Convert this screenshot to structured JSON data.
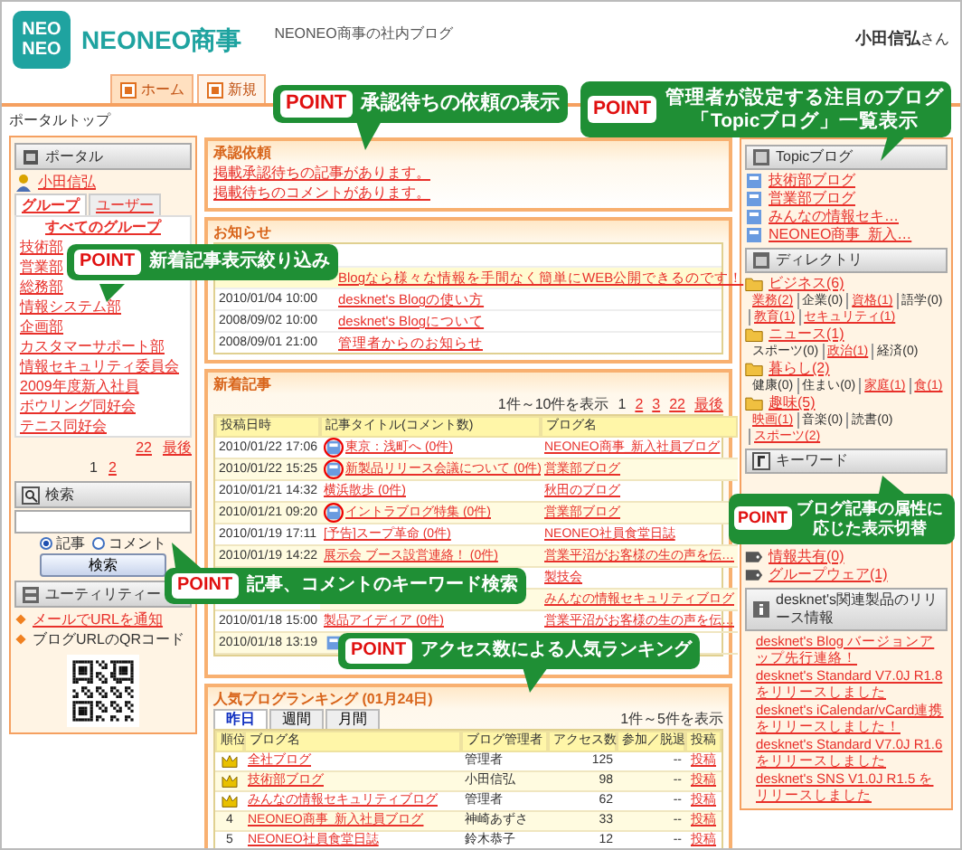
{
  "header": {
    "logo_lines": [
      "NEO",
      "NEO"
    ],
    "site_name": "NEONEO商事",
    "tagline": "NEONEO商事の社内ブログ",
    "user_name": "小田信弘",
    "user_suffix": "さん"
  },
  "nav_tabs": [
    {
      "label": "ホーム",
      "selected": true
    },
    {
      "label": "新規",
      "selected": false
    }
  ],
  "breadcrumb": "ポータルトップ",
  "portal": {
    "title": "ポータル",
    "user": "小田信弘",
    "tabs": [
      {
        "label": "グループ",
        "selected": true
      },
      {
        "label": "ユーザー",
        "selected": false
      }
    ],
    "all_groups": "すべてのグループ",
    "groups": [
      "技術部",
      "営業部",
      "総務部",
      "情報システム部",
      "企画部",
      "カスタマーサポート部",
      "情報セキュリティ委員会",
      "2009年度新入社員",
      "ボウリング同好会",
      "テニス同好会"
    ],
    "pager_next": "22",
    "pager_last": "最後",
    "pages": [
      {
        "label": "1",
        "selected": true
      },
      {
        "label": "2",
        "selected": false
      }
    ]
  },
  "search": {
    "title": "検索",
    "options": [
      {
        "label": "記事",
        "selected": true
      },
      {
        "label": "コメント",
        "selected": false
      }
    ],
    "button": "検索"
  },
  "utility": {
    "title": "ユーティリティー",
    "items": [
      {
        "label": "メールでURLを通知",
        "linked": true
      },
      {
        "label": "ブログURLのQRコード",
        "linked": false
      }
    ]
  },
  "approval": {
    "title": "承認依頼",
    "items": [
      "掲載承認待ちの記事があります。",
      "掲載待ちのコメントがあります。"
    ]
  },
  "notices": {
    "title": "お知らせ",
    "rows": [
      {
        "date": "",
        "title": "Blogなら様々な情報を手間なく簡単にWEB公開できるのです！"
      },
      {
        "date": "2010/01/04 10:00",
        "title": "desknet's Blogの使い方"
      },
      {
        "date": "2008/09/02 10:00",
        "title": "desknet's Blogについて"
      },
      {
        "date": "2008/09/01 21:00",
        "title": "管理者からのお知らせ"
      }
    ]
  },
  "articles": {
    "title": "新着記事",
    "count": "1件～10件を表示",
    "pages": [
      {
        "label": "1",
        "selected": true
      },
      {
        "label": "2",
        "selected": false
      },
      {
        "label": "3",
        "selected": false
      }
    ],
    "pager_next": "22",
    "pager_last": "最後",
    "columns": [
      "投稿日時",
      "記事タイトル(コメント数)",
      "ブログ名"
    ],
    "rows": [
      {
        "date": "2010/01/22 17:06",
        "icon": true,
        "circled": true,
        "title": "東京：浅町へ (0件)",
        "blog": "NEONEO商事_新入社員ブログ"
      },
      {
        "date": "2010/01/22 15:25",
        "icon": true,
        "circled": true,
        "title": "新製品リリース会議について (0件)",
        "blog": "営業部ブログ"
      },
      {
        "date": "2010/01/21 14:32",
        "icon": false,
        "title": "横浜散歩 (0件)",
        "blog": "秋田のブログ"
      },
      {
        "date": "2010/01/21 09:20",
        "icon": true,
        "circled": true,
        "title": "イントラブログ特集 (0件)",
        "blog": "営業部ブログ"
      },
      {
        "date": "2010/01/19 17:11",
        "icon": false,
        "title": "[予告]スープ革命 (0件)",
        "blog": "NEONEO社員食堂日誌"
      },
      {
        "date": "2010/01/19 14:22",
        "icon": false,
        "title": "展示会 ブース設営連絡！ (0件)",
        "blog": "営業平沼がお客様の生の声を伝…"
      },
      {
        "date": "",
        "icon": false,
        "title": "",
        "blog": "製技会"
      },
      {
        "date": "",
        "icon": false,
        "title": "",
        "blog": "みんなの情報セキュリティブログ"
      },
      {
        "date": "2010/01/18 15:00",
        "icon": false,
        "title": "製品アイディア (0件)",
        "blog": "営業平沼がお客様の生の声を伝…"
      },
      {
        "date": "2010/01/18 13:19",
        "icon": true,
        "circled": false,
        "title": "",
        "blog": ""
      }
    ]
  },
  "ranking": {
    "title": "人気ブログランキング (01月24日)",
    "tabs": [
      {
        "label": "昨日",
        "selected": true
      },
      {
        "label": "週間",
        "selected": false
      },
      {
        "label": "月間",
        "selected": false
      }
    ],
    "count": "1件～5件を表示",
    "columns": [
      "順位",
      "ブログ名",
      "ブログ管理者",
      "アクセス数",
      "参加／脱退",
      "投稿"
    ],
    "rows": [
      {
        "rank": "",
        "crown": true,
        "blog": "全社ブログ",
        "admin": "管理者",
        "access": "125",
        "join": "--",
        "post": "投稿"
      },
      {
        "rank": "",
        "crown": true,
        "blog": "技術部ブログ",
        "admin": "小田信弘",
        "access": "98",
        "join": "--",
        "post": "投稿"
      },
      {
        "rank": "",
        "crown": true,
        "blog": "みんなの情報セキュリティブログ",
        "admin": "管理者",
        "access": "62",
        "join": "--",
        "post": "投稿"
      },
      {
        "rank": "4",
        "crown": false,
        "blog": "NEONEO商事_新入社員ブログ",
        "admin": "神崎あずさ",
        "access": "33",
        "join": "--",
        "post": "投稿"
      },
      {
        "rank": "5",
        "crown": false,
        "blog": "NEONEO社員食堂日誌",
        "admin": "鈴木恭子",
        "access": "12",
        "join": "--",
        "post": "投稿"
      }
    ]
  },
  "topic": {
    "title": "Topicブログ",
    "items": [
      "技術部ブログ",
      "営業部ブログ",
      "みんなの情報セキ…",
      "NEONEO商事_新入…"
    ]
  },
  "directory": {
    "title": "ディレクトリ",
    "categories": [
      {
        "name": "ビジネス(6)",
        "subs": [
          {
            "label": "業務(2)",
            "linked": true
          },
          {
            "label": "企業(0)",
            "linked": false
          },
          {
            "label": "資格(1)",
            "linked": true
          },
          {
            "label": "語学(0)",
            "linked": false
          },
          {
            "label": "教育(1)",
            "linked": true
          },
          {
            "label": "セキュリティ(1)",
            "linked": true
          }
        ]
      },
      {
        "name": "ニュース(1)",
        "subs": [
          {
            "label": "スポーツ(0)",
            "linked": false
          },
          {
            "label": "政治(1)",
            "linked": true
          },
          {
            "label": "経済(0)",
            "linked": false
          }
        ]
      },
      {
        "name": "暮らし(2)",
        "subs": [
          {
            "label": "健康(0)",
            "linked": false
          },
          {
            "label": "住まい(0)",
            "linked": false
          },
          {
            "label": "家庭(1)",
            "linked": true
          },
          {
            "label": "食(1)",
            "linked": true
          }
        ]
      },
      {
        "name": "趣味(5)",
        "subs": [
          {
            "label": "映画(1)",
            "linked": true
          },
          {
            "label": "音楽(0)",
            "linked": false
          },
          {
            "label": "読書(0)",
            "linked": false
          },
          {
            "label": "スポーツ(2)",
            "linked": true
          }
        ]
      }
    ]
  },
  "keyword": {
    "title": "キーワード",
    "items": [
      "情報共有(0)",
      "グループウェア(1)"
    ]
  },
  "releases": {
    "title": "desknet's関連製品のリリース情報",
    "items": [
      "desknet's Blog バージョンアップ先行連絡！",
      "desknet's Standard V7.0J R1.8 をリリースしました",
      "desknet's iCalendar/vCard連携をリリースしました！",
      "desknet's Standard V7.0J R1.6 をリリースしました",
      "desknet's SNS V1.0J R1.5 をリリースしました"
    ]
  },
  "callouts": [
    {
      "tag": "POINT",
      "lines": [
        "承認待ちの依頼の表示"
      ]
    },
    {
      "tag": "POINT",
      "lines": [
        "管理者が設定する注目のブログ",
        "「Topicブログ」一覧表示"
      ]
    },
    {
      "tag": "POINT",
      "lines": [
        "新着記事表示絞り込み"
      ]
    },
    {
      "tag": "POINT",
      "lines": [
        "ブログ記事の属性に",
        "応じた表示切替"
      ]
    },
    {
      "tag": "POINT",
      "lines": [
        "記事、コメントのキーワード検索"
      ]
    },
    {
      "tag": "POINT",
      "lines": [
        "アクセス数による人気ランキング"
      ]
    }
  ]
}
